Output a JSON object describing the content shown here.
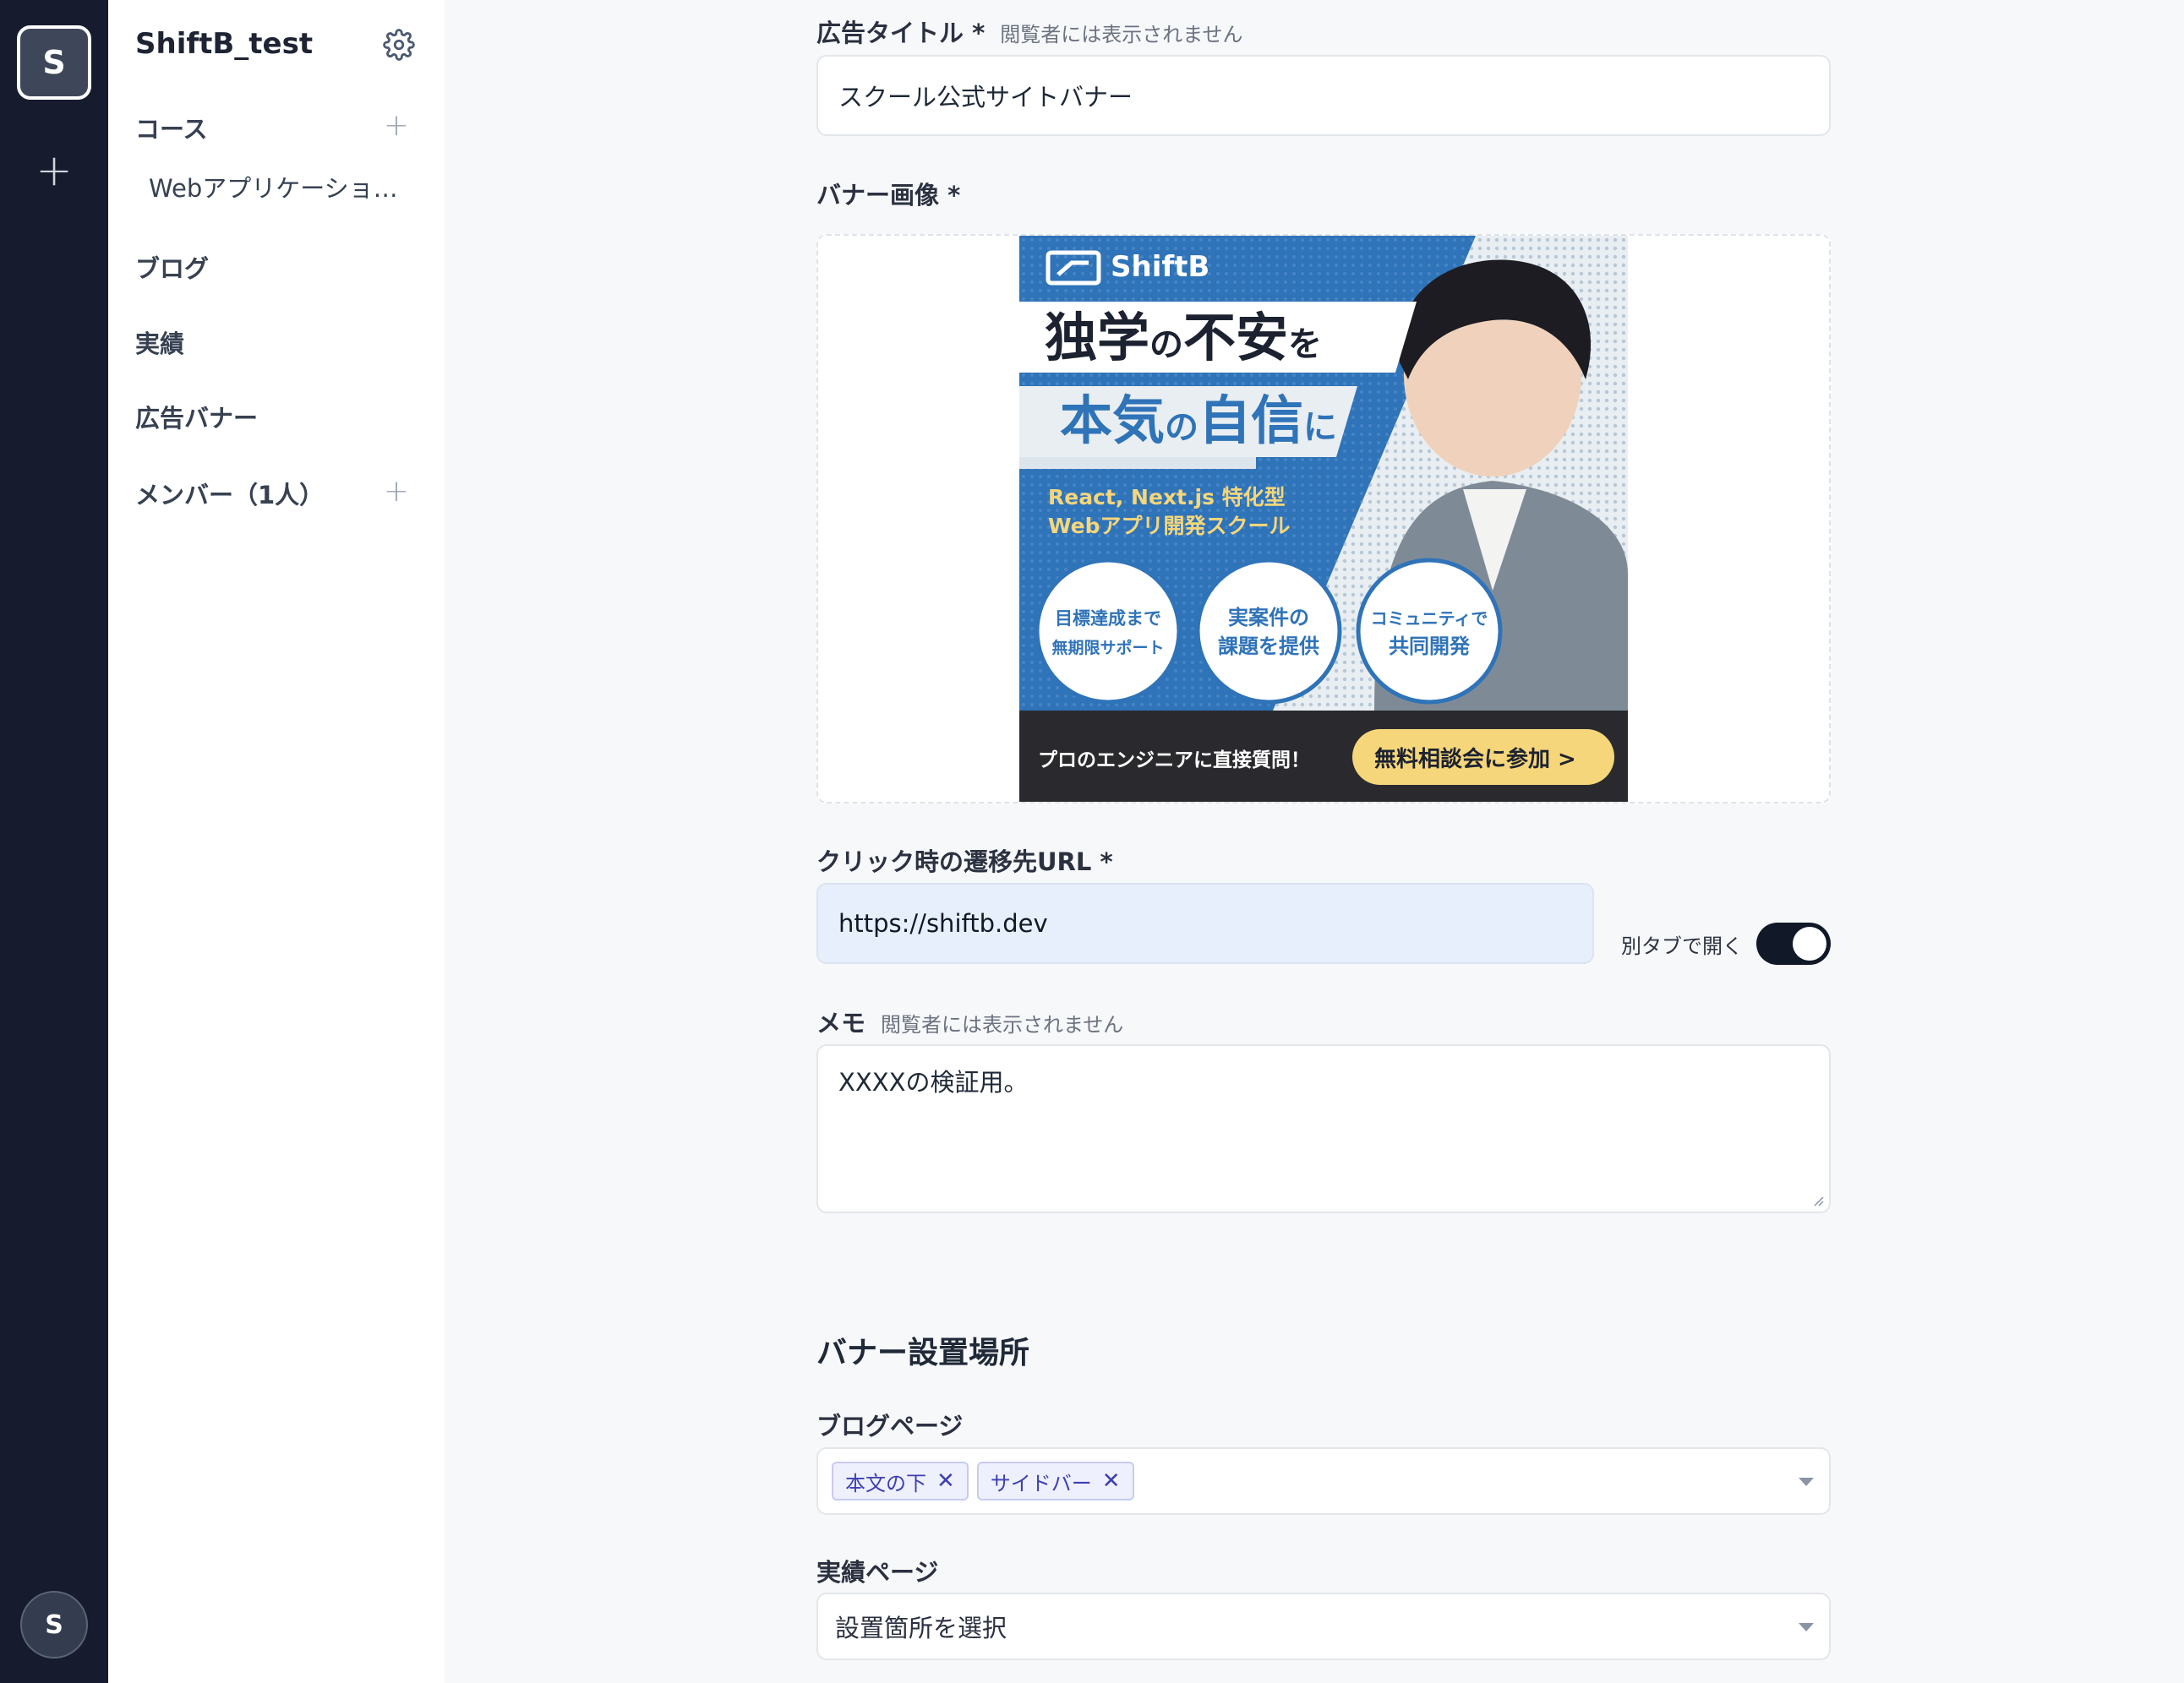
{
  "rail": {
    "workspace_initial": "S",
    "add_label": "+",
    "user_initial": "S"
  },
  "sidebar": {
    "project_title": "ShiftB_test",
    "courses_label": "コース",
    "course_item": "Webアプリケーショ…",
    "blog_label": "ブログ",
    "achievements_label": "実績",
    "ad_banner_label": "広告バナー",
    "members_label": "メンバー（1人）",
    "plus": "+"
  },
  "form": {
    "title_label": "広告タイトル *",
    "hidden_hint": "閲覧者には表示されません",
    "title_value": "スクール公式サイトバナー",
    "image_label": "バナー画像 *",
    "url_label": "クリック時の遷移先URL *",
    "url_value": "https://shiftb.dev",
    "new_tab_label": "別タブで開く",
    "new_tab_on": true,
    "memo_label": "メモ",
    "memo_value": "XXXXの検証用。"
  },
  "banner": {
    "brand": "ShiftB",
    "headline_1": [
      "独学",
      "の",
      "不安",
      "を"
    ],
    "headline_2": [
      "本気",
      "の",
      "自信",
      "に"
    ],
    "sub_1": "React, Next.js 特化型",
    "sub_2": "Webアプリ開発スクール",
    "circles": [
      {
        "line1": "目標達成まで",
        "line2": "無期限サポート"
      },
      {
        "line1": "実案件の",
        "line2": "課題を提供"
      },
      {
        "line1": "コミュニティで",
        "line2": "共同開発"
      }
    ],
    "footer_text": "プロのエンジニアに直接質問！",
    "cta": "無料相談会に参加 >"
  },
  "placement": {
    "section_title": "バナー設置場所",
    "blog_label": "ブログページ",
    "blog_chips": [
      "本文の下",
      "サイドバー"
    ],
    "chip_remove": "✕",
    "results_label": "実績ページ",
    "results_placeholder": "設置箇所を選択"
  },
  "colors": {
    "rail_bg": "#161c2e",
    "banner_blue": "#2f73b8",
    "cta_yellow": "#f6d67a",
    "chip_text": "#3f3fb2"
  }
}
